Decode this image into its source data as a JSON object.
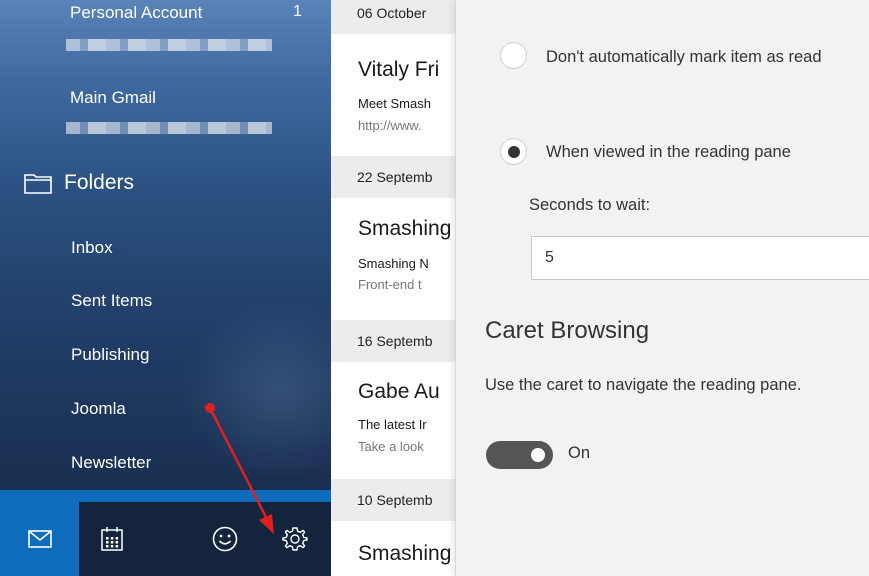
{
  "sidebar": {
    "accounts": [
      {
        "label": "Personal Account",
        "count": "1"
      },
      {
        "label": "Main Gmail"
      }
    ],
    "folders_label": "Folders",
    "folder_items": [
      "Inbox",
      "Sent Items",
      "Publishing",
      "Joomla",
      "Newsletter"
    ],
    "bottom_nav": {
      "mail_icon": "mail-icon",
      "calendar_icon": "calendar-icon",
      "feedback_icon": "smiley-icon",
      "settings_icon": "gear-icon"
    }
  },
  "message_list": {
    "groups": [
      {
        "date": "06 October",
        "messages": [
          {
            "sender": "Vitaly Fri",
            "subject": "Meet Smash",
            "preview": "http://www."
          }
        ]
      },
      {
        "date": "22 Septemb",
        "messages": [
          {
            "sender": "Smashing",
            "subject": "Smashing N",
            "preview": "Front-end t"
          }
        ]
      },
      {
        "date": "16 Septemb",
        "messages": [
          {
            "sender": "Gabe Au",
            "subject": "The latest Ir",
            "preview": "Take a look"
          }
        ]
      },
      {
        "date": "10 Septemb",
        "messages": [
          {
            "sender": "Smashing",
            "subject": "",
            "preview": ""
          }
        ]
      }
    ]
  },
  "settings": {
    "radio_options": [
      {
        "label": "Don't automatically mark item as read",
        "checked": false
      },
      {
        "label": "When viewed in the reading pane",
        "checked": true
      }
    ],
    "seconds_label": "Seconds to wait:",
    "seconds_value": "5",
    "caret_title": "Caret Browsing",
    "caret_desc": "Use the caret to navigate the reading pane.",
    "caret_toggle": {
      "state": "On",
      "on": true
    }
  },
  "colors": {
    "accent": "#0f6cbd",
    "annotation_arrow": "#e02020",
    "settings_bg": "#f2f2f2",
    "date_header_bg": "#ececec"
  }
}
